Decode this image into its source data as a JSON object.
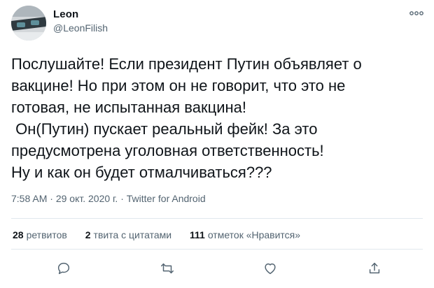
{
  "author": {
    "name": "Leon",
    "handle": "@LeonFilish"
  },
  "tweet": {
    "lines": [
      "Послушайте! Если президент Путин объявляет о",
      "вакцине! Но при этом он не говорит, что это не",
      "готовая, не испытанная вакцина!",
      " Он(Путин) пускает реальный фейк! За это",
      "предусмотрена уголовная ответственность!",
      "Ну и как он будет отмалчиваться???"
    ]
  },
  "meta": {
    "time": "7:58 AM",
    "separator1": " · ",
    "date": "29 окт. 2020 г.",
    "separator2": " · ",
    "source": "Twitter for Android"
  },
  "stats": {
    "retweets_count": "28",
    "retweets_label": "ретвитов",
    "quotes_count": "2",
    "quotes_label": "твита с цитатами",
    "likes_count": "111",
    "likes_label": "отметок «Нравится»"
  },
  "icons": {
    "more": "more-horizontal-icon",
    "reply": "reply-icon",
    "retweet": "retweet-icon",
    "like": "heart-icon",
    "share": "share-icon"
  },
  "colors": {
    "text": "#0f1419",
    "secondary": "#536471",
    "divider": "#e1e8ed"
  }
}
